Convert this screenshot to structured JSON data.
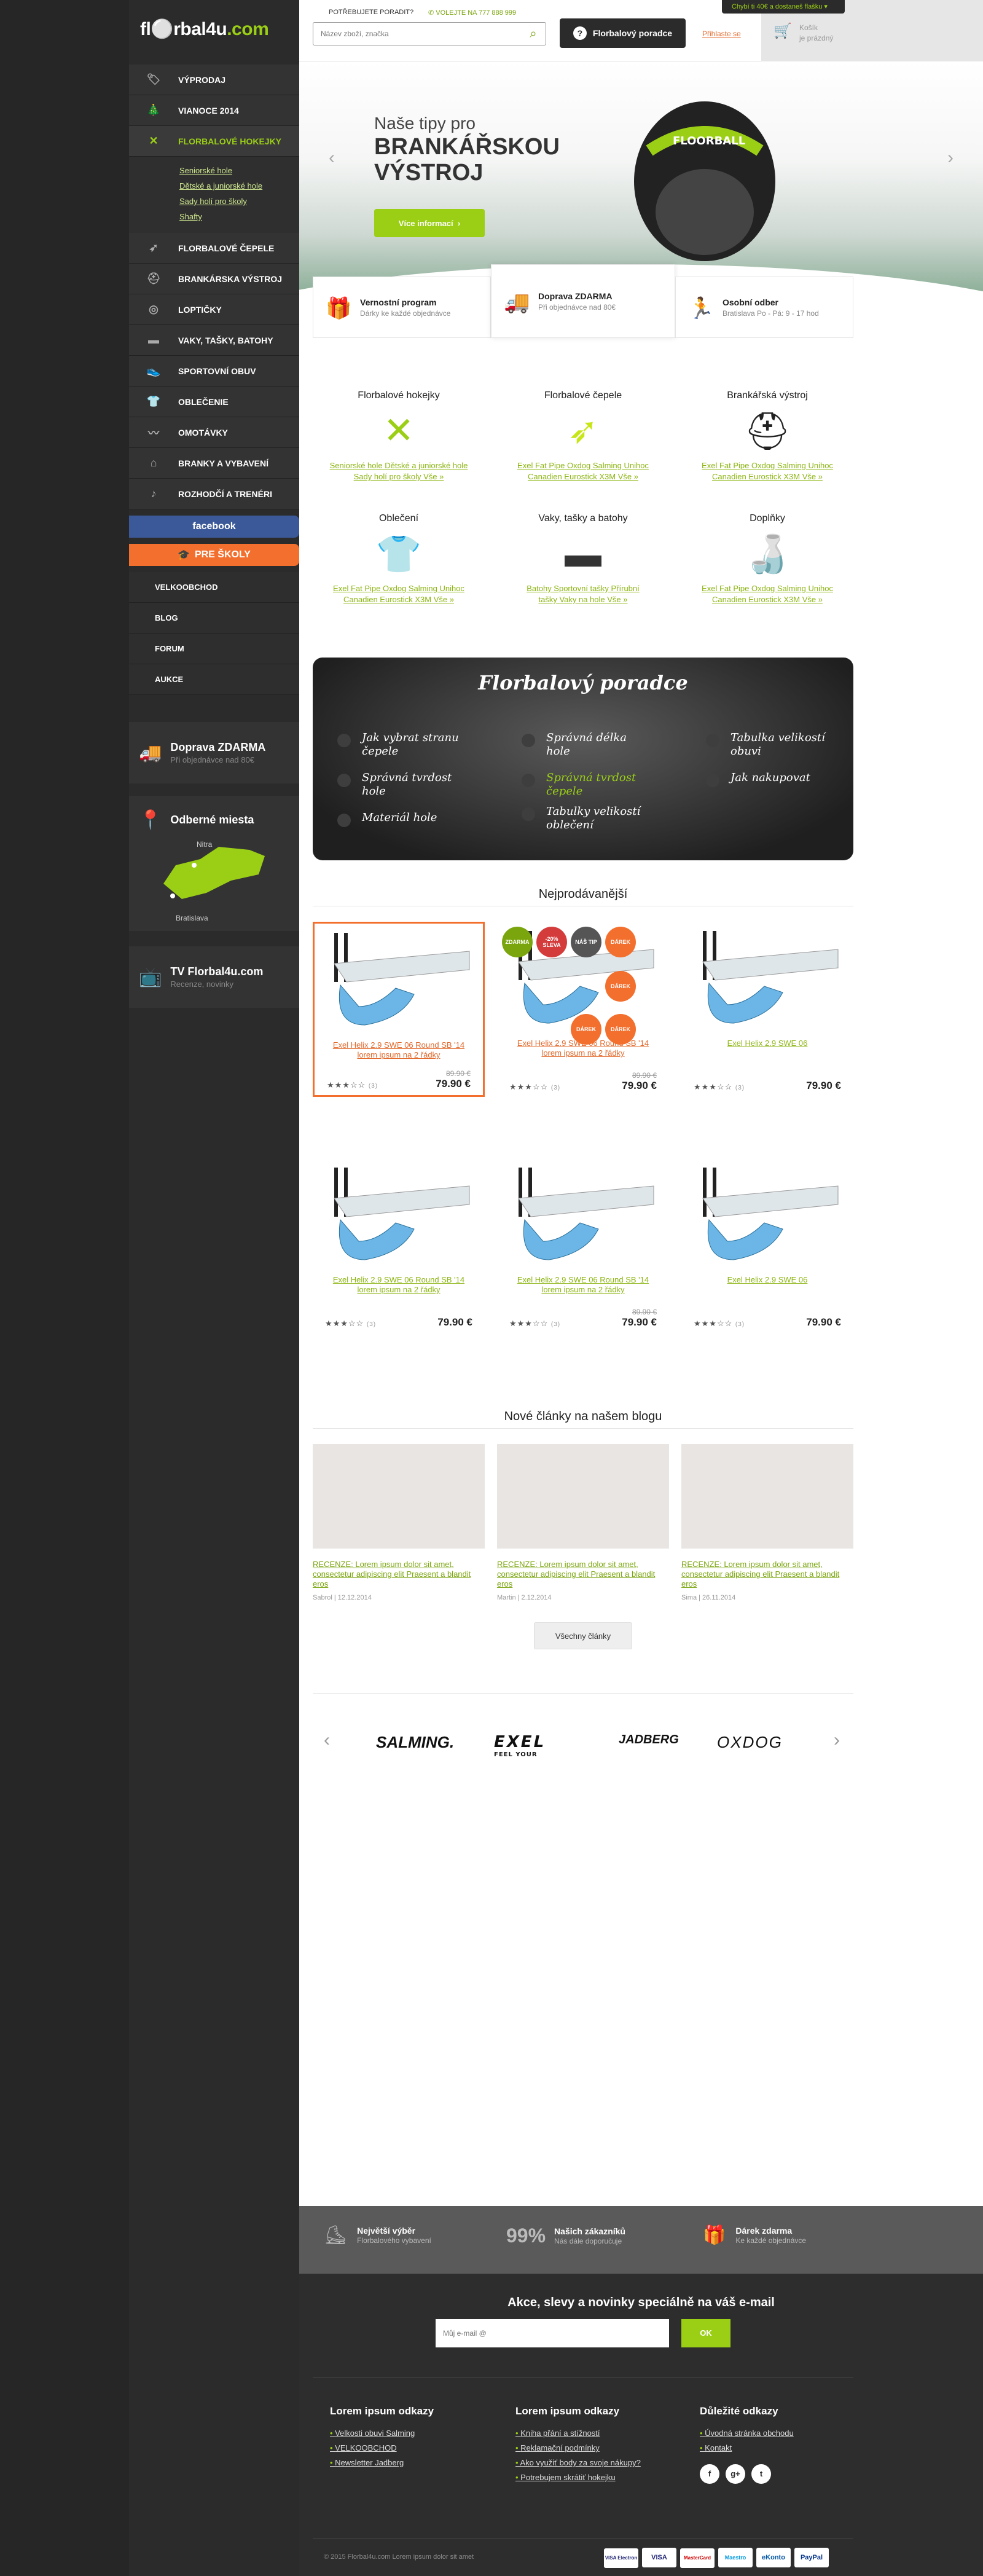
{
  "brand": {
    "logo_pre": "fl",
    "logo_mid": "rbal4u",
    "logo_post": ".com"
  },
  "header": {
    "help_label": "POTŘEBUJETE PORADIT?",
    "phone": "VOLEJTE NA 777 888 999",
    "search_placeholder": "Název zboží, značka",
    "advisor_button": "Florbalový poradce",
    "login": "Přihlaste se",
    "cart_title": "Košík",
    "cart_status": "je prázdný",
    "free_shipping_note": "Chybí ti 40€ a dostaneš flašku"
  },
  "sidebar": {
    "items": [
      {
        "label": "VÝPRODAJ",
        "icon": "tag-icon"
      },
      {
        "label": "VIANOCE 2014",
        "icon": "tree-icon"
      },
      {
        "label": "FLORBALOVÉ HOKEJKY",
        "icon": "sticks-icon"
      }
    ],
    "subitems": [
      "Seniorské hole",
      "Dětské a juniorské hole",
      "Sady holí pro školy",
      "Shafty"
    ],
    "items2": [
      {
        "label": "FLORBALOVÉ ČEPELE",
        "icon": "blade-icon"
      },
      {
        "label": "BRANKÁRSKA VÝSTROJ",
        "icon": "helmet-icon"
      },
      {
        "label": "LOPTIČKY",
        "icon": "ball-icon"
      },
      {
        "label": "VAKY, TAŠKY, BATOHY",
        "icon": "bag-icon"
      },
      {
        "label": "SPORTOVNÍ OBUV",
        "icon": "shoe-icon"
      },
      {
        "label": "OBLEČENIE",
        "icon": "shirt-icon"
      },
      {
        "label": "OMOTÁVKY",
        "icon": "grip-icon"
      },
      {
        "label": "BRANKY A VYBAVENÍ",
        "icon": "goal-icon"
      },
      {
        "label": "ROZHODČÍ A TRENÉRI",
        "icon": "whistle-icon"
      }
    ],
    "facebook": "facebook",
    "schools": "PRE ŠKOLY",
    "links": [
      "VELKOOBCHOD",
      "BLOG",
      "FORUM",
      "AUKCE"
    ],
    "shipping": {
      "title": "Doprava ZDARMA",
      "sub": "Při objednávce nad 80€"
    },
    "places": {
      "title": "Odberné miesta",
      "city1": "Nitra",
      "city2": "Bratislava"
    },
    "tv": {
      "title": "TV Florbal4u.com",
      "sub": "Recenze, novinky"
    }
  },
  "hero": {
    "pre": "Naše tipy pro",
    "line1": "BRANKÁŘSKOU",
    "line2": "VÝSTROJ",
    "button": "Více informací",
    "helmet_text": "FLOORBALL"
  },
  "features": [
    {
      "title": "Vernostní program",
      "sub": "Dárky ke každé objednávce"
    },
    {
      "title": "Doprava ZDARMA",
      "sub": "Při objednávce nad 80€"
    },
    {
      "title": "Osobní odber",
      "sub": "Bratislava Po - Pá: 9 - 17 hod"
    }
  ],
  "categories": [
    {
      "title": "Florbalové hokejky",
      "l1": "Seniorské hole  Dětské a juniorské hole",
      "l2": "Sady holí pro školy  Vše »"
    },
    {
      "title": "Florbalové čepele",
      "l1": "Exel  Fat Pipe  Oxdog  Salming  Unihoc",
      "l2": "Canadien  Eurostick  X3M  Vše »"
    },
    {
      "title": "Brankářská výstroj",
      "l1": "Exel  Fat Pipe  Oxdog  Salming  Unihoc",
      "l2": "Canadien  Eurostick  X3M  Vše »"
    },
    {
      "title": "Oblečení",
      "l1": "Exel  Fat Pipe  Oxdog  Salming  Unihoc",
      "l2": "Canadien  Eurostick  X3M  Vše »"
    },
    {
      "title": "Vaky, tašky a batohy",
      "l1": "Batohy  Sportovní tašky  Přírubní",
      "l2": "tašky  Vaky na hole  Vše »"
    },
    {
      "title": "Doplňky",
      "l1": "Exel  Fat Pipe  Oxdog  Salming  Unihoc",
      "l2": "Canadien  Eurostick  X3M  Vše »"
    }
  ],
  "advisor": {
    "title": "Florbalový poradce",
    "q": [
      "Jak vybrat stranu čepele",
      "Správná délka hole",
      "Tabulka velikostí obuvi",
      "Správná tvrdost hole",
      "Správná tvrdost čepele",
      "Jak nakupovat",
      "Materiál hole",
      "Tabulky velikostí oblečení"
    ]
  },
  "bestsellers": {
    "title": "Nejprodávanější",
    "items": [
      {
        "name": "Exel Helix 2.9 SWE 06 Round SB '14 lorem ipsum na 2 řádky",
        "old": "89.90 €",
        "price": "79.90 €",
        "stars": "★★★☆☆",
        "rev": "(3)"
      },
      {
        "name": "Exel Helix 2.9 SWE 06 Round SB '14 lorem ipsum na 2 řádky",
        "old": "89.90 €",
        "price": "79.90 €",
        "stars": "★★★☆☆",
        "rev": "(3)"
      },
      {
        "name": "Exel Helix 2.9 SWE 06",
        "old": "",
        "price": "79.90 €",
        "stars": "★★★☆☆",
        "rev": "(3)"
      },
      {
        "name": "Exel Helix 2.9 SWE 06 Round SB '14 lorem ipsum na 2 řádky",
        "old": "",
        "price": "79.90 €",
        "stars": "★★★☆☆",
        "rev": "(3)"
      },
      {
        "name": "Exel Helix 2.9 SWE 06 Round SB '14 lorem ipsum na 2 řádky",
        "old": "89.90 €",
        "price": "79.90 €",
        "stars": "★★★☆☆",
        "rev": "(3)"
      },
      {
        "name": "Exel Helix 2.9 SWE 06",
        "old": "",
        "price": "79.90 €",
        "stars": "★★★☆☆",
        "rev": "(3)"
      }
    ],
    "badges": {
      "new": "ZDARMA",
      "sale": "-20% SLEVA",
      "tip": "NÁŠ TIP",
      "gift": "DÁREK"
    }
  },
  "blog": {
    "title": "Nové články na našem blogu",
    "items": [
      {
        "title": "RECENZE: Lorem ipsum dolor sit amet, consectetur adipiscing elit Praesent a blandit eros",
        "date": "Sabrol  |  12.12.2014"
      },
      {
        "title": "RECENZE: Lorem ipsum dolor sit amet, consectetur adipiscing elit Praesent a blandit eros",
        "date": "Martin  |  2.12.2014"
      },
      {
        "title": "RECENZE: Lorem ipsum dolor sit amet, consectetur adipiscing elit Praesent a blandit eros",
        "date": "Sima  |  26.11.2014"
      }
    ],
    "all": "Všechny články"
  },
  "brands": [
    "SALMING.",
    "EXEL",
    "JADBERG",
    "OXDOG"
  ],
  "brand_sub": "FEEL YOUR",
  "footer": {
    "strip": [
      {
        "title": "Největší výběr",
        "sub": "Florbalového vybavení"
      },
      {
        "big": "99%",
        "title": "Našich zákazníků",
        "sub": "Nás dále doporučuje"
      },
      {
        "title": "Dárek zdarma",
        "sub": "Ke každé objednávce"
      }
    ],
    "newsletter_title": "Akce, slevy a novinky speciálně na váš e-mail",
    "email_placeholder": "Můj e-mail @",
    "ok": "OK",
    "cols": [
      {
        "h": "Lorem ipsum odkazy",
        "links": [
          "Velkosti obuvi Salming",
          "VELKOOBCHOD",
          "Newsletter Jadberg"
        ]
      },
      {
        "h": "Lorem ipsum odkazy",
        "links": [
          "Kniha přání a stížností",
          "Reklamační podmínky",
          "Ako využiť body za svoje nákupy?",
          "Potrebujem skrátiť hokejku"
        ]
      },
      {
        "h": "Důležité odkazy",
        "links": [
          "Úvodná stránka obchodu",
          "Kontakt"
        ]
      }
    ],
    "copyright": "© 2015 Florbal4u.com Lorem ipsum dolor sit amet",
    "payments": [
      "VISA Electron",
      "VISA",
      "MasterCard",
      "Maestro",
      "eKonto",
      "PayPal"
    ]
  }
}
